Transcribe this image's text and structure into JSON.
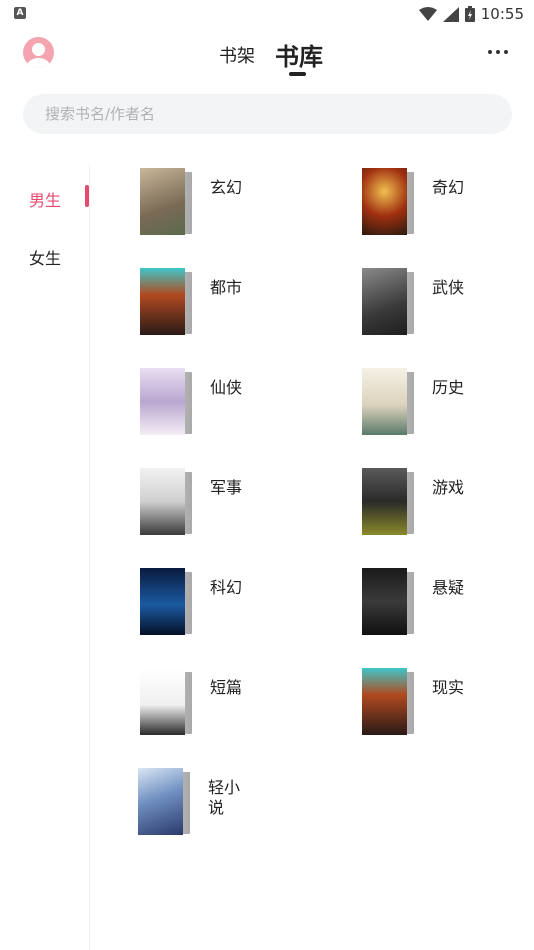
{
  "status_bar": {
    "time": "10:55",
    "app_icon_letter": "A"
  },
  "header": {
    "tabs": [
      {
        "label": "书架"
      },
      {
        "label": "书库"
      }
    ]
  },
  "search": {
    "placeholder": "搜索书名/作者名"
  },
  "sidenav": {
    "items": [
      {
        "label": "男生"
      },
      {
        "label": "女生"
      }
    ]
  },
  "categories": [
    {
      "label": "玄幻"
    },
    {
      "label": "奇幻"
    },
    {
      "label": "都市"
    },
    {
      "label": "武侠"
    },
    {
      "label": "仙侠"
    },
    {
      "label": "历史"
    },
    {
      "label": "军事"
    },
    {
      "label": "游戏"
    },
    {
      "label": "科幻"
    },
    {
      "label": "悬疑"
    },
    {
      "label": "短篇"
    },
    {
      "label": "现实"
    },
    {
      "label": "轻小说"
    }
  ],
  "colors": {
    "accent": "#e84a6f"
  }
}
